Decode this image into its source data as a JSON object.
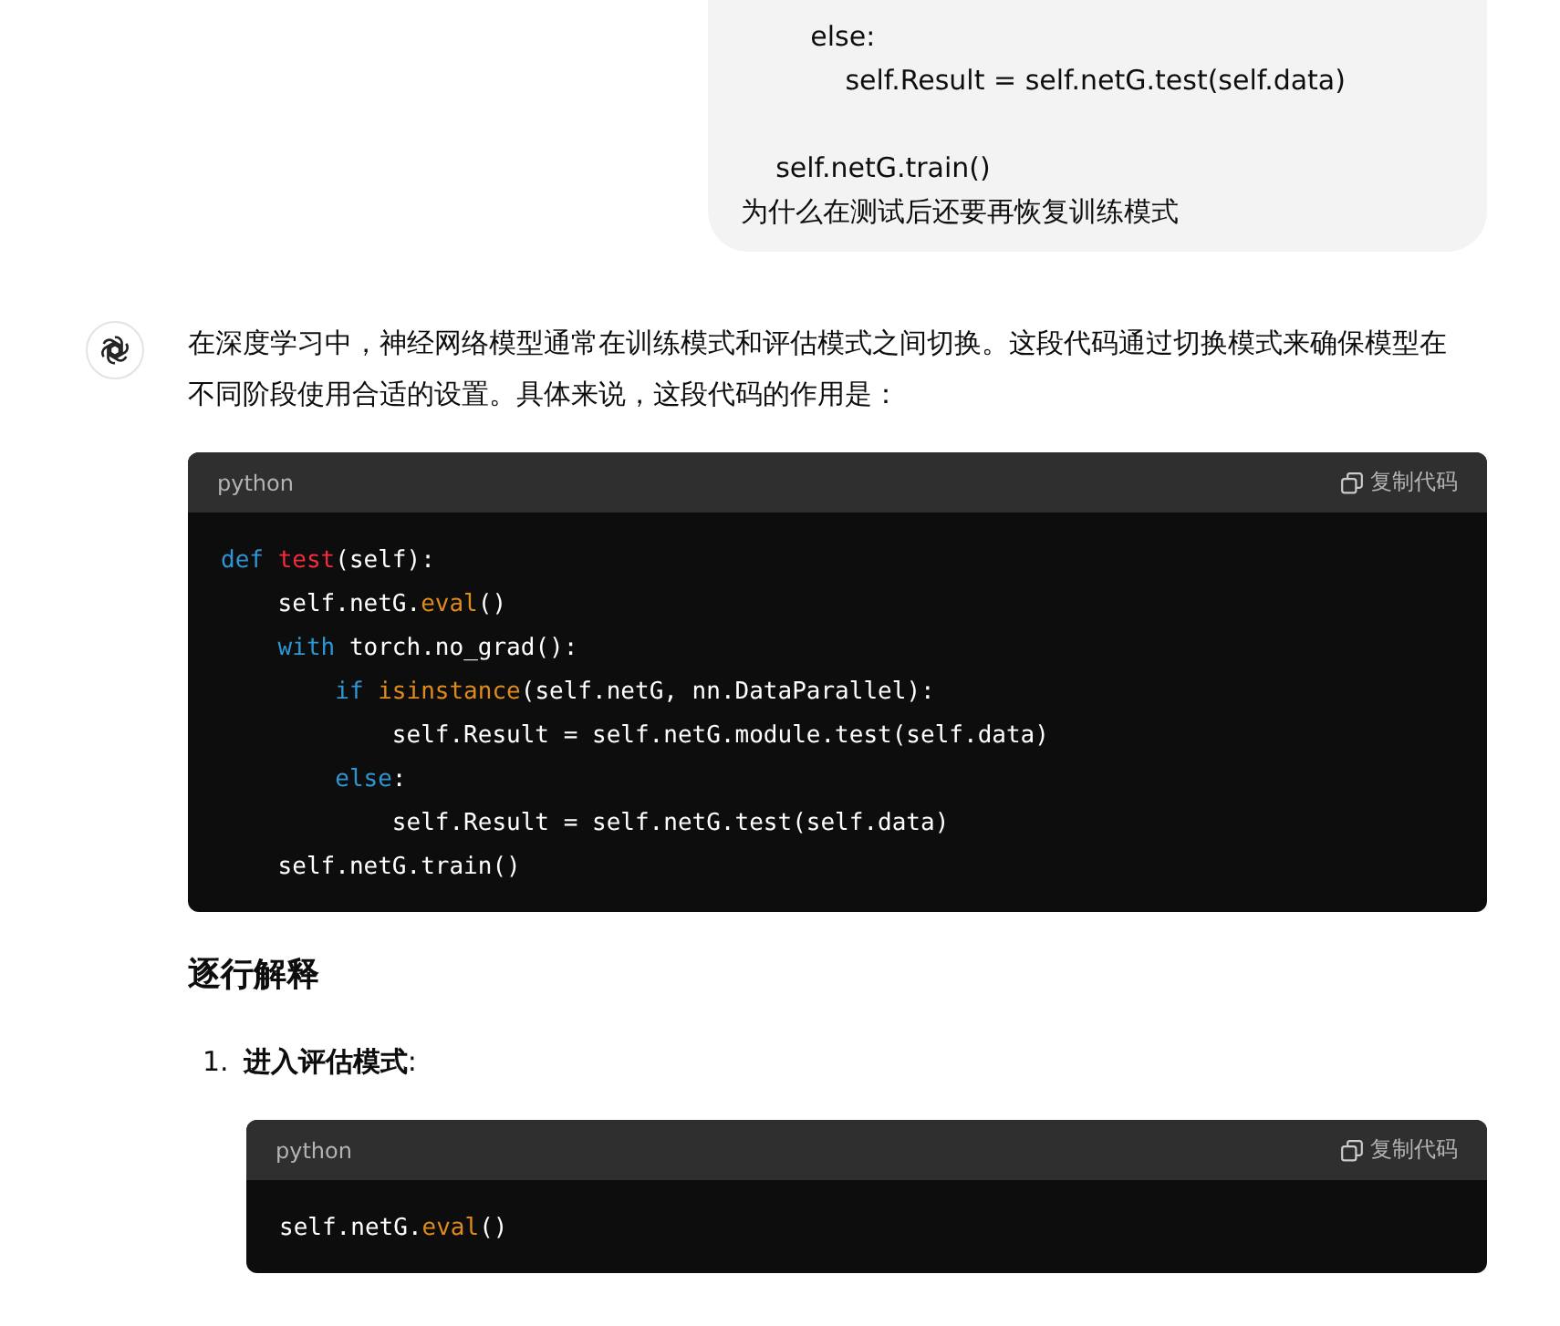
{
  "user_message": {
    "lines": [
      {
        "kind": "code",
        "text": "        else:"
      },
      {
        "kind": "code",
        "text": "            self.Result = self.netG.test(self.data)"
      },
      {
        "kind": "blank"
      },
      {
        "kind": "code",
        "text": "    self.netG.train()"
      },
      {
        "kind": "question",
        "text": "为什么在测试后还要再恢复训练模式"
      }
    ]
  },
  "assistant_message": {
    "intro": "在深度学习中，神经网络模型通常在训练模式和评估模式之间切换。这段代码通过切换模式来确保模型在不同阶段使用合适的设置。具体来说，这段代码的作用是：",
    "code_block": {
      "language": "python",
      "copy_label": "复制代码",
      "lines": [
        [
          {
            "kind": "keyword",
            "text": "def "
          },
          {
            "kind": "function",
            "text": "test"
          },
          {
            "kind": "plain",
            "text": "(self):"
          }
        ],
        [
          {
            "kind": "plain",
            "text": "    self.netG."
          },
          {
            "kind": "builtin",
            "text": "eval"
          },
          {
            "kind": "plain",
            "text": "()"
          }
        ],
        [
          {
            "kind": "keyword",
            "text": "    with "
          },
          {
            "kind": "plain",
            "text": "torch.no_grad():"
          }
        ],
        [
          {
            "kind": "keyword",
            "text": "        if "
          },
          {
            "kind": "builtin",
            "text": "isinstance"
          },
          {
            "kind": "plain",
            "text": "(self.netG, nn.DataParallel):"
          }
        ],
        [
          {
            "kind": "plain",
            "text": "            self.Result = self.netG.module.test(self.data)"
          }
        ],
        [
          {
            "kind": "keyword",
            "text": "        else"
          },
          {
            "kind": "plain",
            "text": ":"
          }
        ],
        [
          {
            "kind": "plain",
            "text": "            self.Result = self.netG.test(self.data)"
          }
        ],
        [
          {
            "kind": "plain",
            "text": "    self.netG.train()"
          }
        ]
      ]
    },
    "heading": "逐行解释",
    "steps": [
      {
        "number": "1.",
        "title": "进入评估模式",
        "suffix": ":",
        "code_block": {
          "language": "python",
          "copy_label": "复制代码",
          "lines": [
            [
              {
                "kind": "plain",
                "text": "self.netG."
              },
              {
                "kind": "builtin",
                "text": "eval"
              },
              {
                "kind": "plain",
                "text": "()"
              }
            ]
          ]
        }
      }
    ]
  }
}
